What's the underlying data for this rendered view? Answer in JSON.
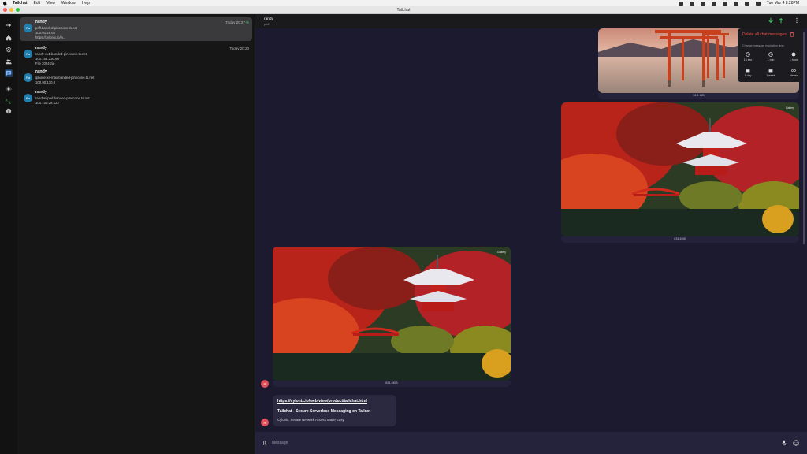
{
  "menubar": {
    "app": "Tailchat",
    "items": [
      "Edit",
      "View",
      "Window",
      "Help"
    ],
    "clock": "Tue Mar 4 8:28PM"
  },
  "window": {
    "title": "Tailchat"
  },
  "chats": [
    {
      "name": "randy",
      "time": "Today 20:27",
      "time_extra": "+5",
      "lines": [
        "pofl.banded-pinecone.ts.net",
        "100.01.28.60",
        "https://cylonix.io/w..."
      ],
      "avatar": "Ra"
    },
    {
      "name": "randy",
      "time": "Today 20:20",
      "lines": [
        "randy-cx1.banded-pinecone.ts.net",
        "100.104.230.80",
        "File 2024.zip"
      ],
      "avatar": "Ra"
    },
    {
      "name": "randy",
      "time": "",
      "lines": [
        "iphone-xs-max.banded-pinecone.ts.net",
        "100.90.130.0"
      ],
      "avatar": "Ra"
    },
    {
      "name": "randy",
      "time": "",
      "lines": [
        "randys-ipad.banded-pinecone.ts.net",
        "100.106.28.122"
      ],
      "avatar": "Ra"
    }
  ],
  "header": {
    "name": "randy",
    "sub": "pofl"
  },
  "messages": {
    "img1_size": "51.1 KiB",
    "img2_size": "631.6KiB",
    "img2_tag": "Gallery",
    "img3_size": "631.6KiB",
    "img3_tag": "Gallery",
    "sender_avatar": "R",
    "link_url": "https://cylonix.io/web/view/product/tailchat.html",
    "link_title": "Tailchat - Secure Serverless Messaging on Tailnet",
    "link_desc": "Cylonix, Secure Network Access Made Easy"
  },
  "popover": {
    "delete_label": "Delete all chat messages",
    "subtitle": "Change message expiration time:",
    "options": [
      "15 sec",
      "1 min",
      "1 hour",
      "1 day",
      "1 week",
      "Never"
    ]
  },
  "composer": {
    "placeholder": "Message"
  },
  "colors": {
    "accent_red": "#ff4d4d",
    "avatar_blue": "#1f7eac",
    "avatar_red": "#e0505a",
    "arrow_green": "#3bbf5f"
  }
}
